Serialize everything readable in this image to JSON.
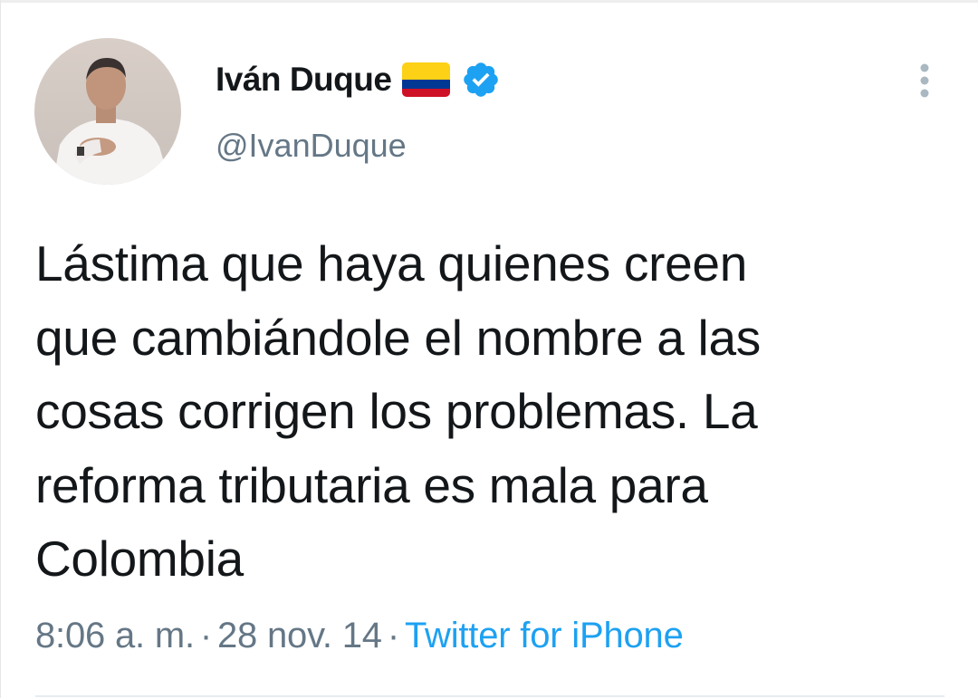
{
  "author": {
    "display_name": "Iván Duque",
    "handle": "@IvanDuque",
    "avatar_icon": "profile-photo",
    "flag_icon": "colombia-flag-icon",
    "verified_icon": "verified-badge-icon"
  },
  "tweet": {
    "lines": [
      "Lástima que haya quienes creen",
      "que cambiándole el nombre a las",
      "cosas corrigen los problemas. La",
      "reforma tributaria es mala para",
      "Colombia"
    ],
    "time": "8:06 a. m.",
    "separator": "·",
    "date": "28 nov. 14",
    "source": "Twitter for iPhone"
  },
  "colors": {
    "text": "#14171a",
    "secondary": "#657786",
    "accent": "#1da1f2",
    "flag_yellow": "#FCD116",
    "flag_blue": "#003893",
    "flag_red": "#CE1126"
  },
  "menu_icon": "more-vertical-icon"
}
